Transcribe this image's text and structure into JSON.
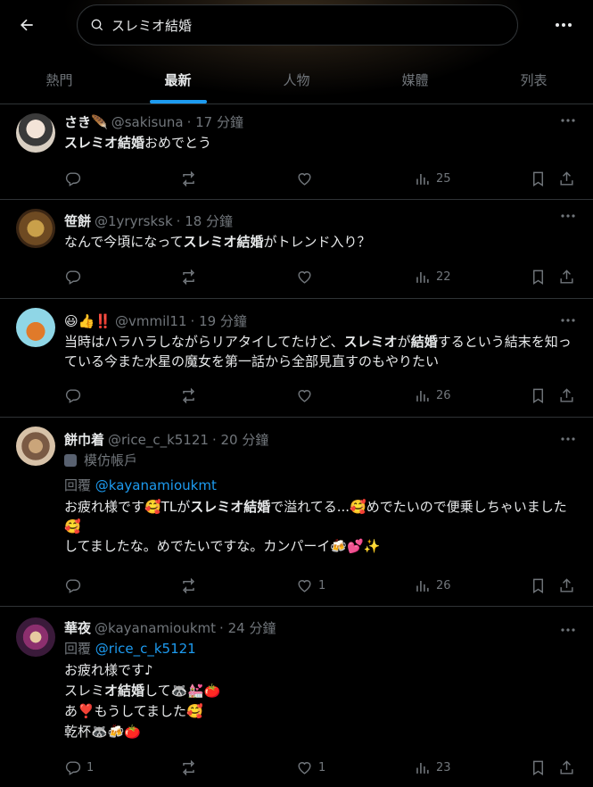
{
  "search": {
    "query": "スレミオ結婚"
  },
  "tabs": [
    "熱門",
    "最新",
    "人物",
    "媒體",
    "列表"
  ],
  "active_tab": 1,
  "posts": [
    {
      "name": "さき🪶",
      "handle": "@sakisuna",
      "time": "· 17 分鐘",
      "lines": [
        {
          "pre": "",
          "bold": "スレミオ結婚",
          "post": "おめでとう"
        }
      ],
      "reply_count": "",
      "like_count": "",
      "views": "25"
    },
    {
      "name": "笹餅",
      "handle": "@1yryrsksk",
      "time": "· 18 分鐘",
      "lines": [
        {
          "pre": "なんで今頃になって",
          "bold": "スレミオ結婚",
          "post": "がトレンド入り？"
        }
      ],
      "reply_count": "",
      "like_count": "",
      "views": "22"
    },
    {
      "name": "😃👍‼️",
      "handle": "@vmmil11",
      "time": "· 19 分鐘",
      "lines": [
        {
          "pre": "当時はハラハラしながらリアタイしてたけど、",
          "bold": "スレミオ",
          "post": "が"
        },
        {
          "pre": "",
          "bold": "結婚",
          "post": "するという結末を知っている今また水星の魔女を第一話から全部見直すのもやりたい"
        }
      ],
      "reply_count": "",
      "like_count": "",
      "views": "26"
    },
    {
      "name": "餅巾着",
      "handle": "@rice_c_k5121",
      "time": "· 20 分鐘",
      "badge": "模仿帳戶",
      "reply_label": "回覆",
      "reply_target": "@kayanamioukmt",
      "lines": [
        {
          "pre": "お疲れ様です🥰TLが",
          "bold": "スレミオ結婚",
          "post": "で溢れてる...🥰めでたいので便乗しちゃいました🥰"
        },
        {
          "pre": "してましたな。めでたいですな。カンパーイ🍻💕✨",
          "bold": "",
          "post": ""
        }
      ],
      "reply_count": "",
      "like_count": "1",
      "views": "26"
    },
    {
      "name": "華夜",
      "handle": "@kayanamioukmt",
      "time": "· 24 分鐘",
      "reply_label": "回覆",
      "reply_target": "@rice_c_k5121",
      "lines": [
        {
          "pre": "お疲れ様です♪",
          "bold": "",
          "post": ""
        },
        {
          "pre": "スレミ",
          "bold": "オ結婚",
          "post": "して🦝💒🍅"
        },
        {
          "pre": "あ❣️もうしてました🥰",
          "bold": "",
          "post": ""
        },
        {
          "pre": "乾杯🦝🍻🍅",
          "bold": "",
          "post": ""
        }
      ],
      "reply_count": "1",
      "like_count": "1",
      "views": "23"
    }
  ],
  "icons": {
    "back": "arrow-left-icon",
    "search": "search-icon",
    "more": "more-icon",
    "reply": "reply-icon",
    "retweet": "retweet-icon",
    "like": "heart-icon",
    "views": "views-icon",
    "bookmark": "bookmark-icon",
    "share": "share-icon"
  },
  "colors": {
    "accent": "#1d9bf0",
    "muted": "#71767b",
    "text": "#e7e9ea",
    "border": "#2f3336"
  }
}
